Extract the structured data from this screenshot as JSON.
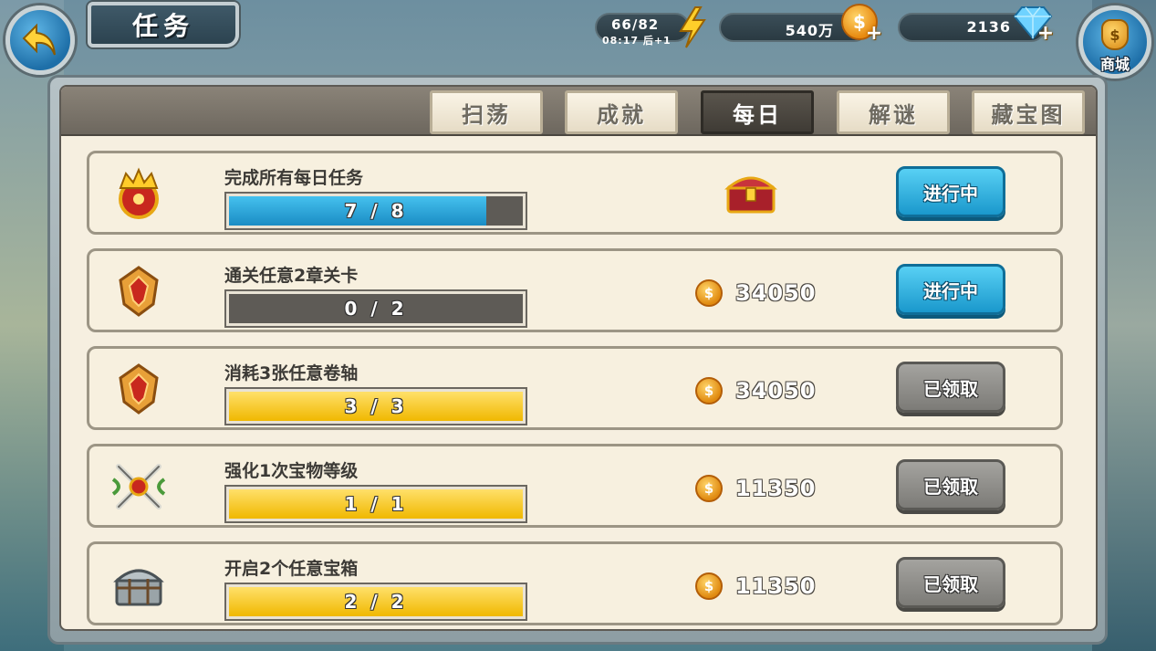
{
  "header": {
    "title": "任务",
    "back_icon": "back-arrow-icon",
    "stamina": {
      "value": "66/82",
      "timer": "08:17 后+1",
      "current": 66,
      "max": 82
    },
    "gold": {
      "value": "540万"
    },
    "gems": {
      "value": "2136"
    },
    "shop_label": "商城"
  },
  "tabs": [
    {
      "label": "扫荡",
      "active": false
    },
    {
      "label": "成就",
      "active": false
    },
    {
      "label": "每日",
      "active": true
    },
    {
      "label": "解谜",
      "active": false
    },
    {
      "label": "藏宝图",
      "active": false
    }
  ],
  "tasks": [
    {
      "title": "完成所有每日任务",
      "progress": "7 / 8",
      "current": 7,
      "total": 8,
      "bar_color": "blue",
      "reward_type": "chest",
      "reward": "",
      "state": "进行中",
      "state_type": "active",
      "icon": "crown-medal-icon"
    },
    {
      "title": "通关任意2章关卡",
      "progress": "0 / 2",
      "current": 0,
      "total": 2,
      "bar_color": "blue",
      "reward_type": "coin",
      "reward": "34050",
      "state": "进行中",
      "state_type": "active",
      "icon": "gold-emblem-icon"
    },
    {
      "title": "消耗3张任意卷轴",
      "progress": "3 / 3",
      "current": 3,
      "total": 3,
      "bar_color": "yellow",
      "reward_type": "coin",
      "reward": "34050",
      "state": "已领取",
      "state_type": "done",
      "icon": "gold-emblem-icon"
    },
    {
      "title": "强化1次宝物等级",
      "progress": "1 / 1",
      "current": 1,
      "total": 1,
      "bar_color": "yellow",
      "reward_type": "coin",
      "reward": "11350",
      "state": "已领取",
      "state_type": "done",
      "icon": "crossed-swords-icon"
    },
    {
      "title": "开启2个任意宝箱",
      "progress": "2 / 2",
      "current": 2,
      "total": 2,
      "bar_color": "yellow",
      "reward_type": "coin",
      "reward": "11350",
      "state": "已领取",
      "state_type": "done",
      "icon": "silver-chest-icon"
    }
  ],
  "colors": {
    "accent_blue": "#1a98cc",
    "progress_yellow": "#f0b800",
    "panel_bg": "#f6efe0"
  }
}
